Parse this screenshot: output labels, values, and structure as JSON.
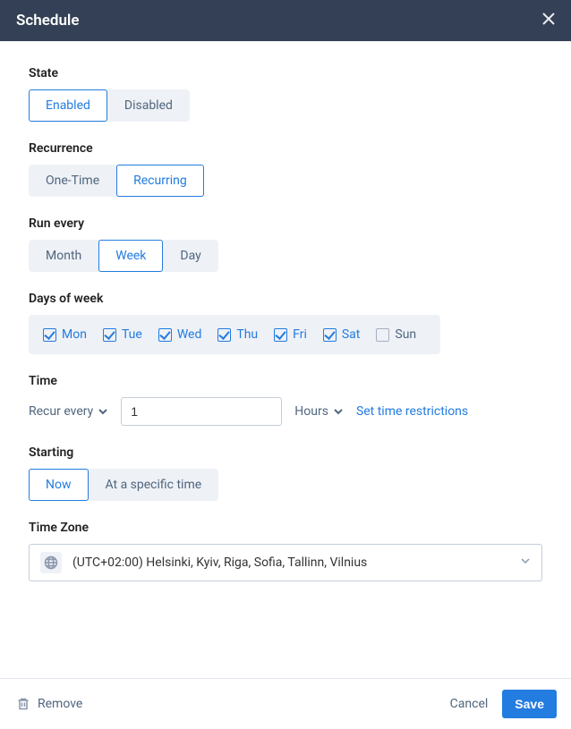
{
  "header": {
    "title": "Schedule"
  },
  "state": {
    "label": "State",
    "options": [
      {
        "label": "Enabled",
        "active": true
      },
      {
        "label": "Disabled",
        "active": false
      }
    ]
  },
  "recurrence": {
    "label": "Recurrence",
    "options": [
      {
        "label": "One-Time",
        "active": false
      },
      {
        "label": "Recurring",
        "active": true
      }
    ]
  },
  "run_every": {
    "label": "Run every",
    "options": [
      {
        "label": "Month",
        "active": false
      },
      {
        "label": "Week",
        "active": true
      },
      {
        "label": "Day",
        "active": false
      }
    ]
  },
  "days": {
    "label": "Days of week",
    "items": [
      {
        "label": "Mon",
        "checked": true
      },
      {
        "label": "Tue",
        "checked": true
      },
      {
        "label": "Wed",
        "checked": true
      },
      {
        "label": "Thu",
        "checked": true
      },
      {
        "label": "Fri",
        "checked": true
      },
      {
        "label": "Sat",
        "checked": true
      },
      {
        "label": "Sun",
        "checked": false
      }
    ]
  },
  "time": {
    "label": "Time",
    "recur_label": "Recur every",
    "value": "1",
    "unit": "Hours",
    "restrictions_link": "Set time restrictions"
  },
  "starting": {
    "label": "Starting",
    "options": [
      {
        "label": "Now",
        "active": true
      },
      {
        "label": "At a specific time",
        "active": false
      }
    ]
  },
  "timezone": {
    "label": "Time Zone",
    "value": "(UTC+02:00) Helsinki, Kyiv, Riga, Sofia, Tallinn, Vilnius"
  },
  "footer": {
    "remove": "Remove",
    "cancel": "Cancel",
    "save": "Save"
  }
}
